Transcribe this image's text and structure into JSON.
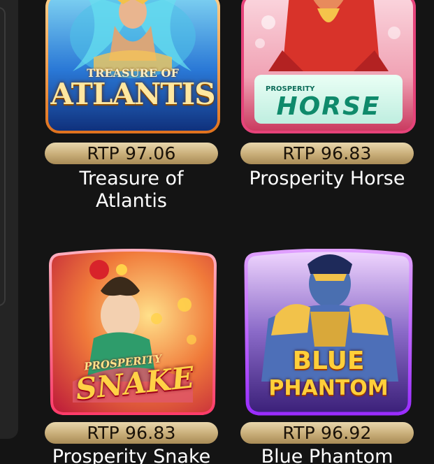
{
  "games": [
    {
      "title": "Treasure of Atlantis",
      "title_lines": [
        "Treasure of",
        "Atlantis"
      ],
      "rtp": "RTP 97.06",
      "logo_small": "TREASURE OF",
      "logo_big": "ATLANTIS",
      "colors": {
        "frame": "#f2a34a",
        "bg": "#1b5fb8"
      }
    },
    {
      "title": "Prosperity Horse",
      "title_lines": [
        "Prosperity Horse",
        ""
      ],
      "rtp": "RTP 96.83",
      "logo_small": "PROSPERITY",
      "logo_big": "HORSE",
      "colors": {
        "frame": "#e24b7a",
        "bg": "#f3c2cf"
      }
    },
    {
      "title": "Prosperity Snake",
      "title_lines": [
        "Prosperity Snake",
        ""
      ],
      "rtp": "RTP 96.83",
      "logo_small": "PROSPERITY",
      "logo_big": "SNAKE",
      "colors": {
        "frame": "#ff6b8a",
        "bg": "#d84a3a"
      }
    },
    {
      "title": "Blue Phantom",
      "title_lines": [
        "Blue Phantom",
        ""
      ],
      "rtp": "RTP 96.92",
      "logo_small": "BLUE",
      "logo_big": "PHANTOM",
      "colors": {
        "frame": "#b44bff",
        "bg": "#6a3aa8"
      }
    }
  ]
}
